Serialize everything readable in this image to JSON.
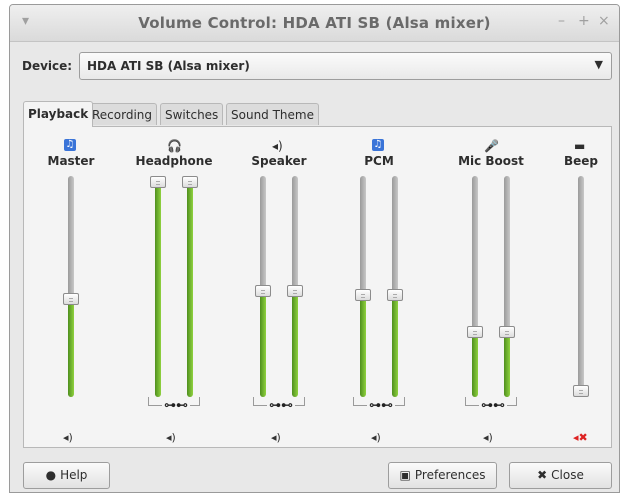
{
  "window": {
    "title": "Volume Control: HDA ATI SB (Alsa mixer)",
    "menu_glyph": "▾",
    "minimize_glyph": "–",
    "maximize_glyph": "+",
    "close_glyph": "×"
  },
  "device": {
    "label": "Device:",
    "value": "HDA ATI SB (Alsa mixer)",
    "arrow": "▼"
  },
  "tabs": [
    "Playback",
    "Recording",
    "Switches",
    "Sound Theme"
  ],
  "active_tab": "Playback",
  "channels": [
    {
      "label": "Master",
      "icon": "music-note-icon",
      "glyph": "♫",
      "levels": [
        0.44
      ],
      "muted": false
    },
    {
      "label": "Headphone",
      "icon": "headphone-icon",
      "glyph": "🎧",
      "levels": [
        1.0,
        1.0
      ],
      "muted": false,
      "locked": true
    },
    {
      "label": "Speaker",
      "icon": "speaker-icon",
      "glyph": "◂)",
      "levels": [
        0.48,
        0.48
      ],
      "muted": false,
      "locked": true
    },
    {
      "label": "PCM",
      "icon": "music-note-icon",
      "glyph": "♫",
      "levels": [
        0.46,
        0.46
      ],
      "muted": false,
      "locked": true
    },
    {
      "label": "Mic Boost",
      "icon": "microphone-icon",
      "glyph": "🎤",
      "levels": [
        0.28,
        0.28
      ],
      "muted": false,
      "locked": true
    },
    {
      "label": "Beep",
      "icon": "beep-icon",
      "glyph": "▬",
      "levels": [
        0.0
      ],
      "muted": true
    }
  ],
  "lock_glyph": "⊶⊷",
  "mute_glyph": "◂)",
  "muted_glyph": "◂✖",
  "buttons": {
    "help": "Help",
    "preferences": "Preferences",
    "close": "Close"
  },
  "button_glyphs": {
    "help": "●",
    "preferences": "▣",
    "close": "✖"
  },
  "colors": {
    "level_fill": "#6cbf2a",
    "title_text": "#6a6a6a",
    "muted": "#d22222",
    "icon_blue": "#3a74d8"
  }
}
